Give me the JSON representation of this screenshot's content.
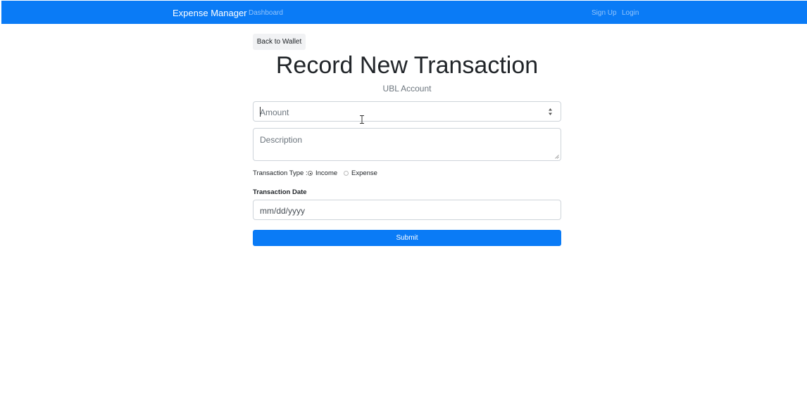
{
  "navbar": {
    "brand": "Expense Manager",
    "links": {
      "dashboard": "Dashboard",
      "signup": "Sign Up",
      "login": "Login"
    }
  },
  "back_button": "Back to Wallet",
  "page_title": "Record New Transaction",
  "account_name": "UBL Account",
  "form": {
    "amount_placeholder": "Amount",
    "description_placeholder": "Description",
    "transaction_type_label": "Transaction Type :",
    "type_options": [
      "Income",
      "Expense"
    ],
    "selected_type": "Income",
    "date_label": "Transaction Date",
    "date_placeholder": "mm/dd/yyyy",
    "submit_label": "Submit"
  },
  "colors": {
    "primary": "#0a7bf6",
    "muted_text": "#6c757d",
    "border": "#ced4da"
  },
  "icons": {
    "spinner": "number-spinner-icon",
    "cursor": "text-cursor-icon",
    "resize": "resize-grip-icon"
  }
}
